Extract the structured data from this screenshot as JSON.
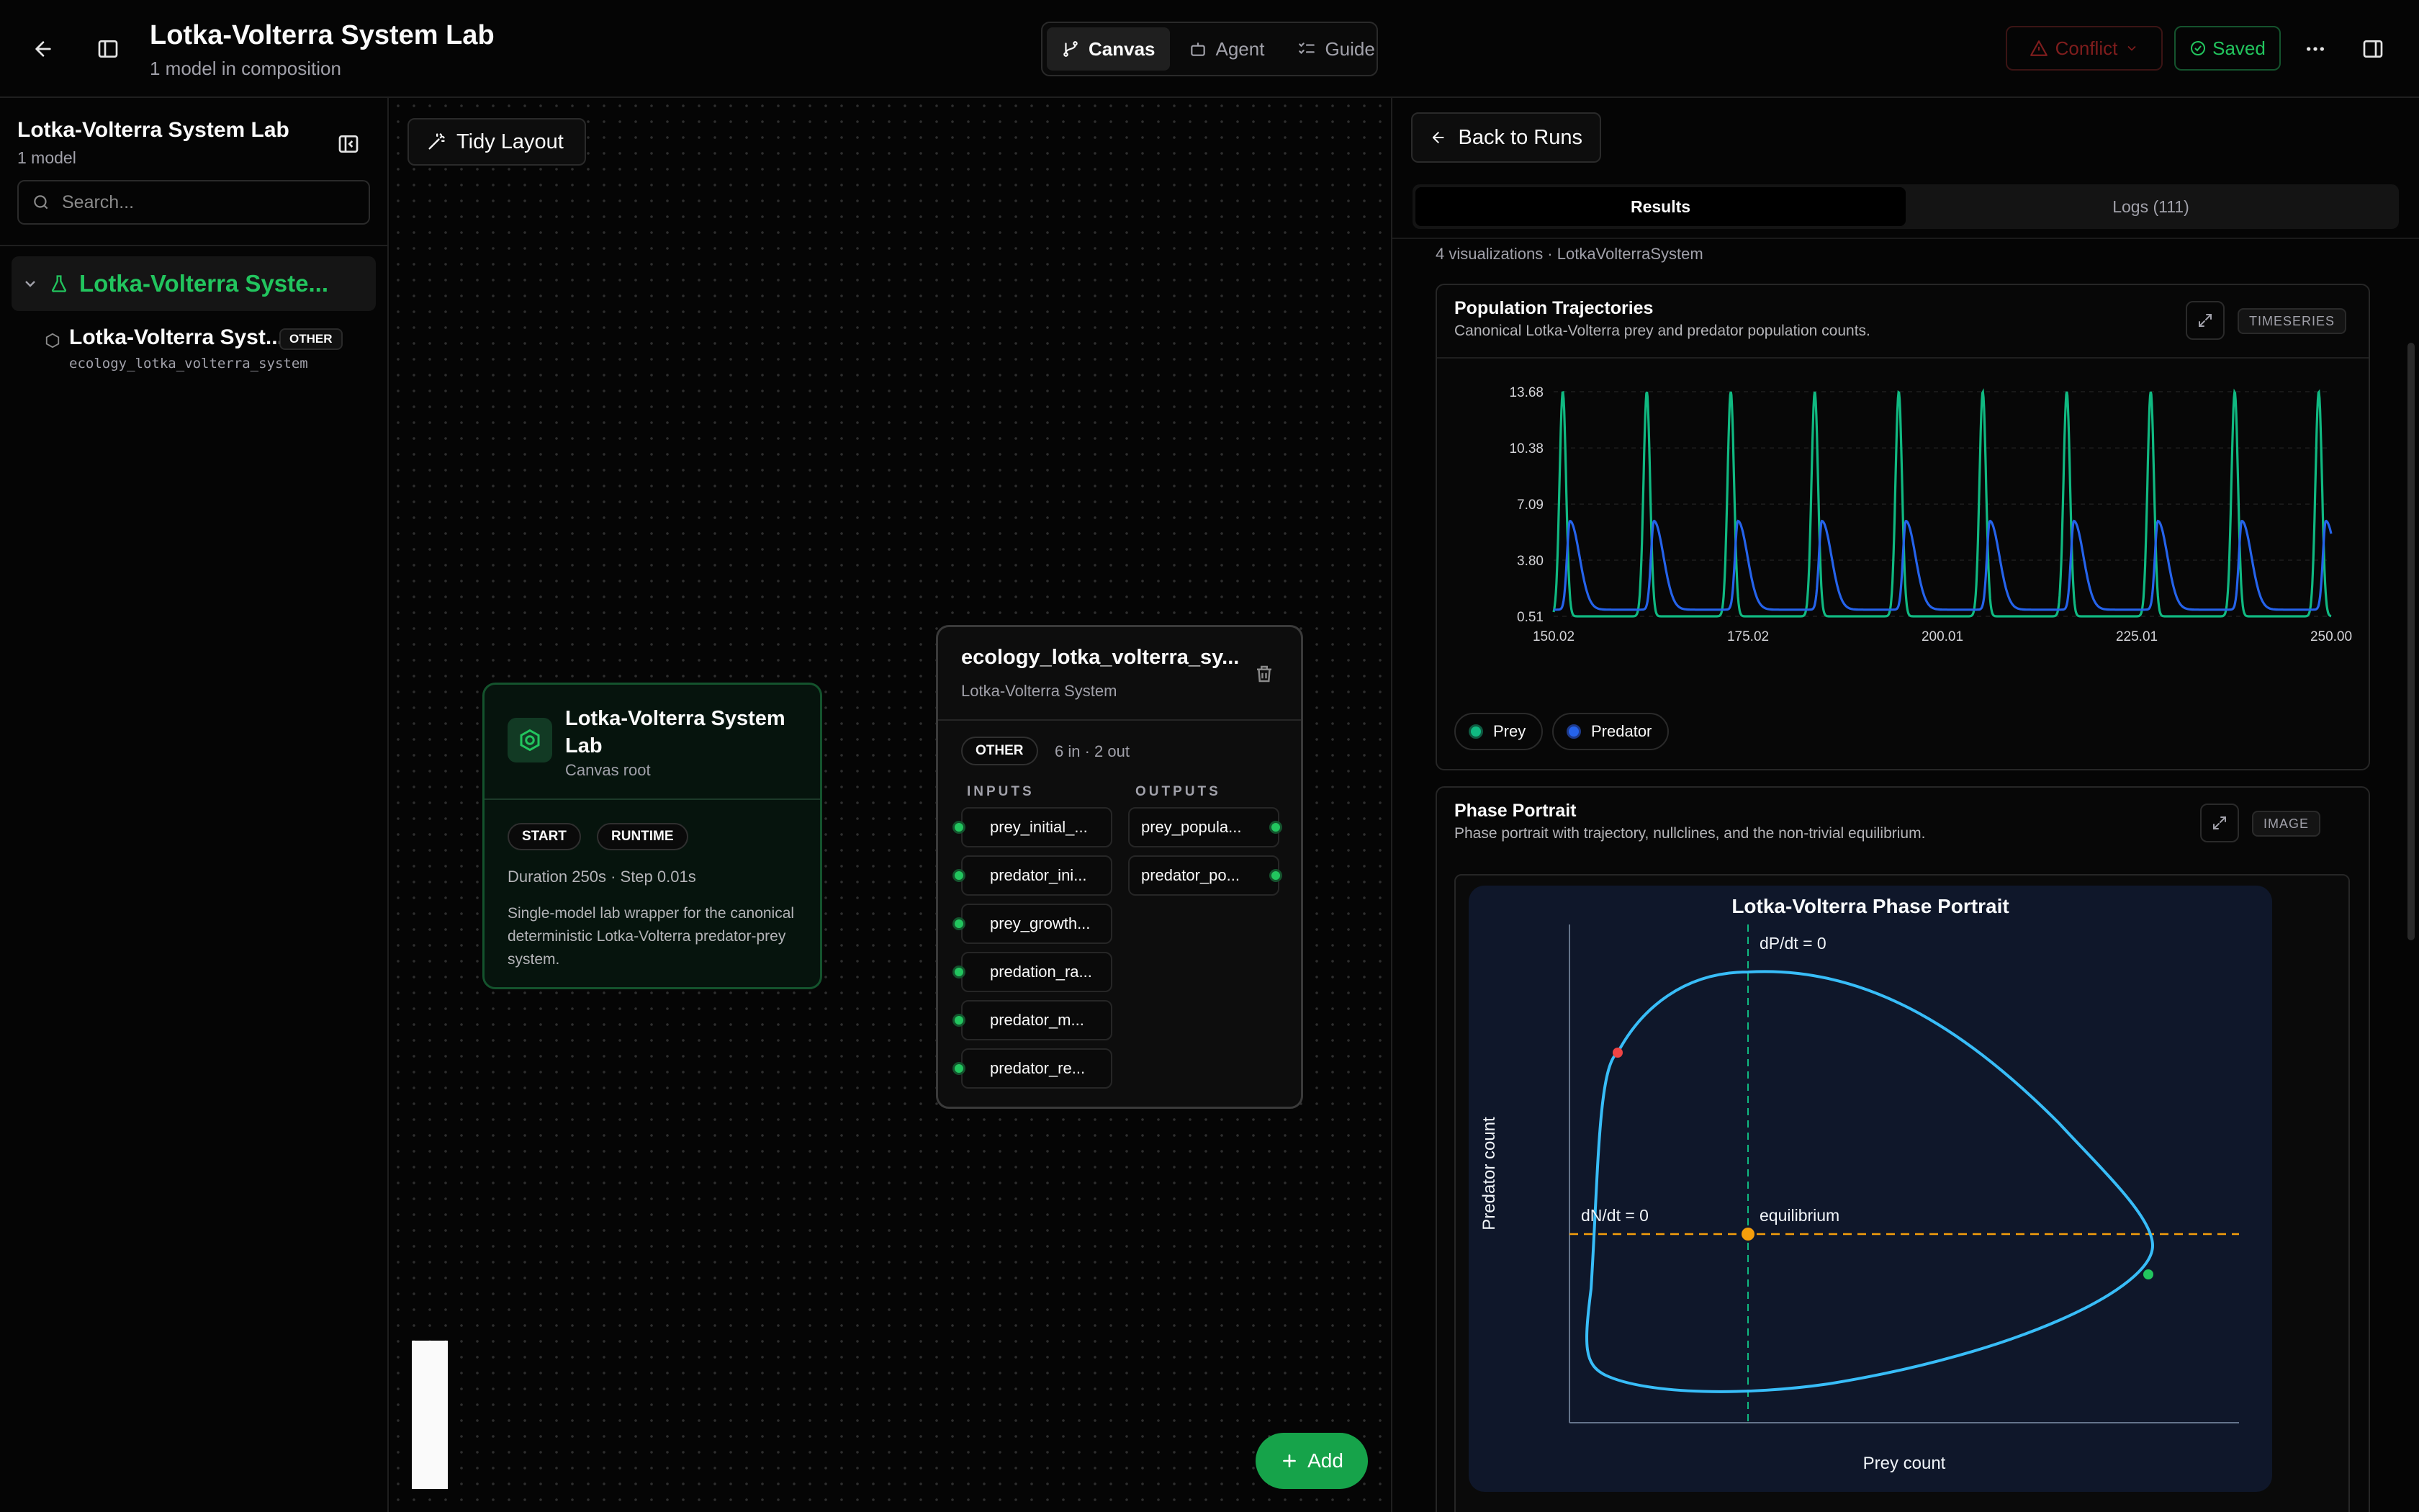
{
  "header": {
    "title": "Lotka-Volterra System Lab",
    "subtitle": "1 model in composition",
    "tabs": [
      {
        "label": "Canvas",
        "active": true
      },
      {
        "label": "Agent",
        "active": false
      },
      {
        "label": "Guide",
        "active": false
      }
    ],
    "conflict_label": "Conflict",
    "saved_label": "Saved"
  },
  "sidebar": {
    "title": "Lotka-Volterra System Lab",
    "subtitle": "1 model",
    "search_placeholder": "Search...",
    "root_item": "Lotka-Volterra Syste...",
    "child": {
      "name": "Lotka-Volterra Syst...",
      "badge": "OTHER",
      "id": "ecology_lotka_volterra_system"
    }
  },
  "canvas": {
    "tidy_label": "Tidy Layout",
    "add_label": "Add",
    "root_node": {
      "title": "Lotka-Volterra System Lab",
      "subtitle": "Canvas root",
      "chips": [
        "START",
        "RUNTIME"
      ],
      "meta": "Duration 250s · Step 0.01s",
      "description": "Single-model lab wrapper for the canonical deterministic Lotka-Volterra predator-prey system."
    },
    "model_node": {
      "title": "ecology_lotka_volterra_sy...",
      "subtitle": "Lotka-Volterra System",
      "chip": "OTHER",
      "io_summary": "6 in · 2 out",
      "inputs_header": "INPUTS",
      "outputs_header": "OUTPUTS",
      "inputs": [
        "prey_initial_...",
        "predator_ini...",
        "prey_growth...",
        "predation_ra...",
        "predator_m...",
        "predator_re..."
      ],
      "outputs": [
        "prey_popula...",
        "predator_po..."
      ]
    }
  },
  "results": {
    "back_label": "Back to Runs",
    "tabs": [
      {
        "label": "Results",
        "active": true
      },
      {
        "label": "Logs (111)",
        "active": false
      }
    ],
    "viz_info": "4 visualizations · LotkaVolterraSystem",
    "cards": [
      {
        "title": "Population Trajectories",
        "description": "Canonical Lotka-Volterra prey and predator population counts.",
        "tag": "TIMESERIES",
        "legend": [
          {
            "label": "Prey",
            "color": "#10b981"
          },
          {
            "label": "Predator",
            "color": "#2563eb"
          }
        ]
      },
      {
        "title": "Phase Portrait",
        "description": "Phase portrait with trajectory, nullclines, and the non-trivial equilibrium.",
        "tag": "IMAGE",
        "plot_title": "Lotka-Volterra Phase Portrait",
        "xlabel": "Prey count",
        "ylabel": "Predator count",
        "annotations": {
          "prey_nullcline": "dP/dt = 0",
          "predator_nullcline": "dN/dt = 0",
          "equilibrium": "equilibrium"
        }
      }
    ]
  },
  "colors": {
    "accent_green": "#22c55e",
    "prey": "#10b981",
    "predator": "#2563eb",
    "phase_curve": "#38bdf8",
    "nullcline_h": "#f59e0b",
    "nullcline_v": "#10b981"
  },
  "chart_data": [
    {
      "type": "line",
      "title": "Population Trajectories",
      "x_ticks": [
        "150.02",
        "175.02",
        "200.01",
        "225.01",
        "250.00"
      ],
      "y_ticks": [
        "0.51",
        "3.80",
        "7.09",
        "10.38",
        "13.68"
      ],
      "xlim": [
        150.02,
        250.0
      ],
      "ylim": [
        0.51,
        13.68
      ],
      "grid": true,
      "period": 10.8,
      "first_prey_peak": 151.2,
      "series": [
        {
          "name": "Prey",
          "min": 0.51,
          "max": 13.68
        },
        {
          "name": "Predator",
          "min": 0.9,
          "max": 6.1
        }
      ]
    }
  ]
}
